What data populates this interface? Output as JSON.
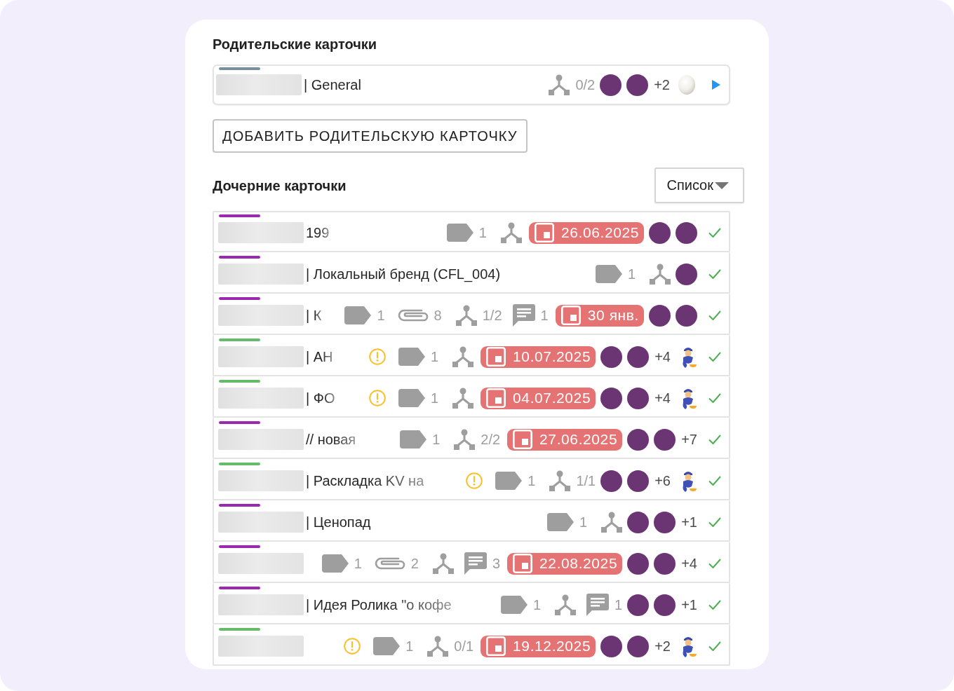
{
  "parent_section": {
    "title": "Родительские карточки",
    "cards": [
      {
        "color": "#78909c",
        "title": "| General",
        "faded": false,
        "items": [
          {
            "kind": "subtasks",
            "count": "0/2"
          },
          {
            "kind": "avatar"
          },
          {
            "kind": "avatar"
          },
          {
            "kind": "more",
            "text": "+2"
          },
          {
            "kind": "egg"
          },
          {
            "kind": "expand"
          }
        ]
      }
    ]
  },
  "add_parent_button": {
    "label": "ДОБАВИТЬ РОДИТЕЛЬСКУЮ КАРТОЧКУ"
  },
  "child_section": {
    "title": "Дочерние карточки",
    "view_select": {
      "value": "Список"
    },
    "cards": [
      {
        "color": "#9c27b0",
        "title": "199",
        "faded": true,
        "items": [
          {
            "kind": "tags",
            "count": "1"
          },
          {
            "kind": "subtasks"
          },
          {
            "kind": "due",
            "date": "26.06.2025"
          },
          {
            "kind": "avatar"
          },
          {
            "kind": "avatar"
          },
          {
            "kind": "done"
          }
        ]
      },
      {
        "color": "#9c27b0",
        "title": "| Локальный бренд (CFL_004)",
        "faded": false,
        "items": [
          {
            "kind": "tags",
            "count": "1"
          },
          {
            "kind": "subtasks"
          },
          {
            "kind": "avatar"
          },
          {
            "kind": "done"
          }
        ]
      },
      {
        "color": "#9c27b0",
        "title": "| К",
        "faded": true,
        "items": [
          {
            "kind": "tags",
            "count": "1"
          },
          {
            "kind": "attachments",
            "count": "8"
          },
          {
            "kind": "subtasks",
            "count": "1/2"
          },
          {
            "kind": "comments",
            "count": "1"
          },
          {
            "kind": "due",
            "date": "30 янв."
          },
          {
            "kind": "avatar"
          },
          {
            "kind": "avatar"
          },
          {
            "kind": "done"
          }
        ]
      },
      {
        "color": "#66bb6a",
        "title": "| АН",
        "faded": true,
        "items": [
          {
            "kind": "warning"
          },
          {
            "kind": "tags",
            "count": "1"
          },
          {
            "kind": "subtasks"
          },
          {
            "kind": "due",
            "date": "10.07.2025"
          },
          {
            "kind": "avatar"
          },
          {
            "kind": "avatar"
          },
          {
            "kind": "more",
            "text": "+4"
          },
          {
            "kind": "mascot"
          },
          {
            "kind": "done"
          }
        ]
      },
      {
        "color": "#66bb6a",
        "title": "| ФО",
        "faded": true,
        "items": [
          {
            "kind": "warning"
          },
          {
            "kind": "tags",
            "count": "1"
          },
          {
            "kind": "subtasks"
          },
          {
            "kind": "due",
            "date": "04.07.2025"
          },
          {
            "kind": "avatar"
          },
          {
            "kind": "avatar"
          },
          {
            "kind": "more",
            "text": "+4"
          },
          {
            "kind": "mascot"
          },
          {
            "kind": "done"
          }
        ]
      },
      {
        "color": "#9c27b0",
        "title": "// новая",
        "faded": true,
        "items": [
          {
            "kind": "tags",
            "count": "1"
          },
          {
            "kind": "subtasks",
            "count": "2/2"
          },
          {
            "kind": "due",
            "date": "27.06.2025"
          },
          {
            "kind": "avatar"
          },
          {
            "kind": "avatar"
          },
          {
            "kind": "more",
            "text": "+7"
          },
          {
            "kind": "done"
          }
        ]
      },
      {
        "color": "#66bb6a",
        "title": "| Раскладка KV на",
        "faded": true,
        "items": [
          {
            "kind": "warning"
          },
          {
            "kind": "tags",
            "count": "1"
          },
          {
            "kind": "subtasks",
            "count": "1/1"
          },
          {
            "kind": "avatar"
          },
          {
            "kind": "avatar"
          },
          {
            "kind": "more",
            "text": "+6"
          },
          {
            "kind": "mascot"
          },
          {
            "kind": "done"
          }
        ]
      },
      {
        "color": "#9c27b0",
        "title": "| Ценопад",
        "faded": false,
        "items": [
          {
            "kind": "tags",
            "count": "1"
          },
          {
            "kind": "subtasks"
          },
          {
            "kind": "avatar"
          },
          {
            "kind": "avatar"
          },
          {
            "kind": "more",
            "text": "+1"
          },
          {
            "kind": "done"
          }
        ]
      },
      {
        "color": "#9c27b0",
        "items": [
          {
            "kind": "tags",
            "count": "1"
          },
          {
            "kind": "attachments",
            "count": "2"
          },
          {
            "kind": "subtasks"
          },
          {
            "kind": "comments",
            "count": "3"
          },
          {
            "kind": "due",
            "date": "22.08.2025"
          },
          {
            "kind": "avatar"
          },
          {
            "kind": "avatar"
          },
          {
            "kind": "more",
            "text": "+4"
          },
          {
            "kind": "done"
          }
        ]
      },
      {
        "color": "#9c27b0",
        "title": "| Идея Ролика \"о кофе",
        "faded": true,
        "items": [
          {
            "kind": "tags",
            "count": "1"
          },
          {
            "kind": "subtasks"
          },
          {
            "kind": "comments",
            "count": "1"
          },
          {
            "kind": "avatar"
          },
          {
            "kind": "avatar"
          },
          {
            "kind": "more",
            "text": "+1"
          },
          {
            "kind": "done"
          }
        ]
      },
      {
        "color": "#66bb6a",
        "items": [
          {
            "kind": "warning"
          },
          {
            "kind": "tags",
            "count": "1"
          },
          {
            "kind": "subtasks",
            "count": "0/1"
          },
          {
            "kind": "due",
            "date": "19.12.2025"
          },
          {
            "kind": "avatar"
          },
          {
            "kind": "avatar"
          },
          {
            "kind": "more",
            "text": "+2"
          },
          {
            "kind": "mascot"
          },
          {
            "kind": "done"
          }
        ]
      }
    ]
  }
}
